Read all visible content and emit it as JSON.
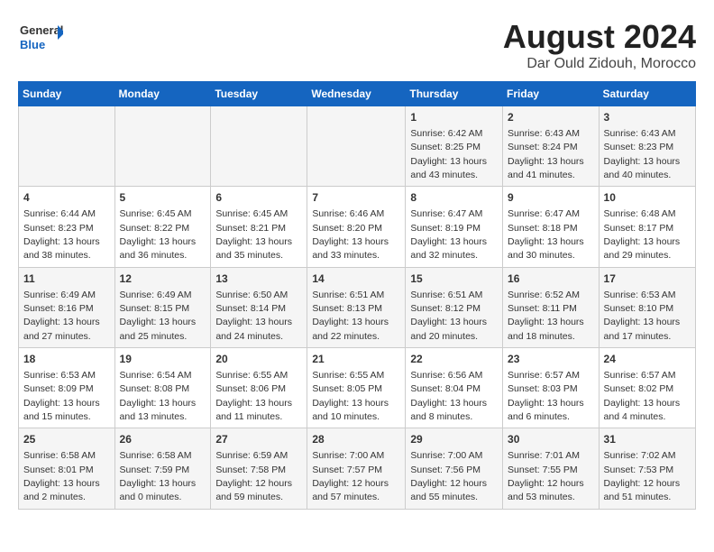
{
  "header": {
    "logo_line1": "General",
    "logo_line2": "Blue",
    "month": "August 2024",
    "location": "Dar Ould Zidouh, Morocco"
  },
  "days_of_week": [
    "Sunday",
    "Monday",
    "Tuesday",
    "Wednesday",
    "Thursday",
    "Friday",
    "Saturday"
  ],
  "weeks": [
    [
      {
        "day": "",
        "info": ""
      },
      {
        "day": "",
        "info": ""
      },
      {
        "day": "",
        "info": ""
      },
      {
        "day": "",
        "info": ""
      },
      {
        "day": "1",
        "info": "Sunrise: 6:42 AM\nSunset: 8:25 PM\nDaylight: 13 hours\nand 43 minutes."
      },
      {
        "day": "2",
        "info": "Sunrise: 6:43 AM\nSunset: 8:24 PM\nDaylight: 13 hours\nand 41 minutes."
      },
      {
        "day": "3",
        "info": "Sunrise: 6:43 AM\nSunset: 8:23 PM\nDaylight: 13 hours\nand 40 minutes."
      }
    ],
    [
      {
        "day": "4",
        "info": "Sunrise: 6:44 AM\nSunset: 8:23 PM\nDaylight: 13 hours\nand 38 minutes."
      },
      {
        "day": "5",
        "info": "Sunrise: 6:45 AM\nSunset: 8:22 PM\nDaylight: 13 hours\nand 36 minutes."
      },
      {
        "day": "6",
        "info": "Sunrise: 6:45 AM\nSunset: 8:21 PM\nDaylight: 13 hours\nand 35 minutes."
      },
      {
        "day": "7",
        "info": "Sunrise: 6:46 AM\nSunset: 8:20 PM\nDaylight: 13 hours\nand 33 minutes."
      },
      {
        "day": "8",
        "info": "Sunrise: 6:47 AM\nSunset: 8:19 PM\nDaylight: 13 hours\nand 32 minutes."
      },
      {
        "day": "9",
        "info": "Sunrise: 6:47 AM\nSunset: 8:18 PM\nDaylight: 13 hours\nand 30 minutes."
      },
      {
        "day": "10",
        "info": "Sunrise: 6:48 AM\nSunset: 8:17 PM\nDaylight: 13 hours\nand 29 minutes."
      }
    ],
    [
      {
        "day": "11",
        "info": "Sunrise: 6:49 AM\nSunset: 8:16 PM\nDaylight: 13 hours\nand 27 minutes."
      },
      {
        "day": "12",
        "info": "Sunrise: 6:49 AM\nSunset: 8:15 PM\nDaylight: 13 hours\nand 25 minutes."
      },
      {
        "day": "13",
        "info": "Sunrise: 6:50 AM\nSunset: 8:14 PM\nDaylight: 13 hours\nand 24 minutes."
      },
      {
        "day": "14",
        "info": "Sunrise: 6:51 AM\nSunset: 8:13 PM\nDaylight: 13 hours\nand 22 minutes."
      },
      {
        "day": "15",
        "info": "Sunrise: 6:51 AM\nSunset: 8:12 PM\nDaylight: 13 hours\nand 20 minutes."
      },
      {
        "day": "16",
        "info": "Sunrise: 6:52 AM\nSunset: 8:11 PM\nDaylight: 13 hours\nand 18 minutes."
      },
      {
        "day": "17",
        "info": "Sunrise: 6:53 AM\nSunset: 8:10 PM\nDaylight: 13 hours\nand 17 minutes."
      }
    ],
    [
      {
        "day": "18",
        "info": "Sunrise: 6:53 AM\nSunset: 8:09 PM\nDaylight: 13 hours\nand 15 minutes."
      },
      {
        "day": "19",
        "info": "Sunrise: 6:54 AM\nSunset: 8:08 PM\nDaylight: 13 hours\nand 13 minutes."
      },
      {
        "day": "20",
        "info": "Sunrise: 6:55 AM\nSunset: 8:06 PM\nDaylight: 13 hours\nand 11 minutes."
      },
      {
        "day": "21",
        "info": "Sunrise: 6:55 AM\nSunset: 8:05 PM\nDaylight: 13 hours\nand 10 minutes."
      },
      {
        "day": "22",
        "info": "Sunrise: 6:56 AM\nSunset: 8:04 PM\nDaylight: 13 hours\nand 8 minutes."
      },
      {
        "day": "23",
        "info": "Sunrise: 6:57 AM\nSunset: 8:03 PM\nDaylight: 13 hours\nand 6 minutes."
      },
      {
        "day": "24",
        "info": "Sunrise: 6:57 AM\nSunset: 8:02 PM\nDaylight: 13 hours\nand 4 minutes."
      }
    ],
    [
      {
        "day": "25",
        "info": "Sunrise: 6:58 AM\nSunset: 8:01 PM\nDaylight: 13 hours\nand 2 minutes."
      },
      {
        "day": "26",
        "info": "Sunrise: 6:58 AM\nSunset: 7:59 PM\nDaylight: 13 hours\nand 0 minutes."
      },
      {
        "day": "27",
        "info": "Sunrise: 6:59 AM\nSunset: 7:58 PM\nDaylight: 12 hours\nand 59 minutes."
      },
      {
        "day": "28",
        "info": "Sunrise: 7:00 AM\nSunset: 7:57 PM\nDaylight: 12 hours\nand 57 minutes."
      },
      {
        "day": "29",
        "info": "Sunrise: 7:00 AM\nSunset: 7:56 PM\nDaylight: 12 hours\nand 55 minutes."
      },
      {
        "day": "30",
        "info": "Sunrise: 7:01 AM\nSunset: 7:55 PM\nDaylight: 12 hours\nand 53 minutes."
      },
      {
        "day": "31",
        "info": "Sunrise: 7:02 AM\nSunset: 7:53 PM\nDaylight: 12 hours\nand 51 minutes."
      }
    ]
  ]
}
